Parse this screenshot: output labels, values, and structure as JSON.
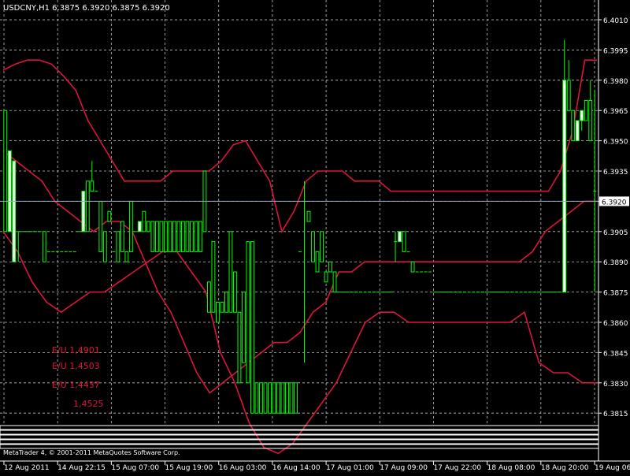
{
  "window": {
    "symbol_header": "USDCNY,H1  6.3875 6.3920 6.3875 6.3920",
    "footer": "MetaTrader 4, © 2001-2011 MetaQuotes Software Corp."
  },
  "annotations": [
    "E/U 1,4901",
    "E/U 1,4503",
    "E/U 1,4437",
    "1,4525"
  ],
  "colors": {
    "background": "#000000",
    "grid": "#c0c0c0",
    "bars": "#00ff00",
    "candle_up_fill": "#ffffff",
    "bands": "#dc143c",
    "annotation_text": "#dc143c",
    "current_price_line": "#9aa6c8",
    "text": "#ffffff"
  },
  "chart_data": {
    "type": "candlestick",
    "title": "USDCNY,H1",
    "header_values": {
      "open": 6.3875,
      "high": 6.392,
      "low": 6.3875,
      "close": 6.392
    },
    "current_price": 6.392,
    "current_price_label": "6.3920",
    "y_ticks": [
      "6.4010",
      "6.3995",
      "6.3980",
      "6.3965",
      "6.3950",
      "6.3935",
      "6.3920",
      "6.3905",
      "6.3890",
      "6.3875",
      "6.3860",
      "6.3845",
      "6.3830",
      "6.3815"
    ],
    "x_ticks": [
      "12 Aug 2011",
      "14 Aug 22:15",
      "15 Aug 07:00",
      "15 Aug 19:00",
      "16 Aug 03:00",
      "16 Aug 14:00",
      "17 Aug 01:00",
      "17 Aug 09:00",
      "17 Aug 22:00",
      "18 Aug 08:00",
      "18 Aug 20:00",
      "19 Aug 06:00"
    ],
    "ylim": [
      6.381,
      6.4019
    ],
    "grid": true,
    "candles_ohlc": [
      [
        6.3965,
        6.3965,
        6.3905,
        6.3905
      ],
      [
        6.3905,
        6.3945,
        6.3905,
        6.3945
      ],
      [
        6.389,
        6.394,
        6.389,
        6.394
      ],
      [
        6.3905,
        6.3905,
        6.389,
        6.3905
      ],
      [
        6.3905,
        6.3905,
        6.3905,
        6.3905
      ],
      [
        6.3905,
        6.3905,
        6.3905,
        6.3905
      ],
      [
        6.3905,
        6.3905,
        6.3905,
        6.3905
      ],
      [
        6.3905,
        6.3905,
        6.3905,
        6.3905
      ],
      [
        6.3905,
        6.3905,
        6.3905,
        6.3905
      ],
      [
        6.3905,
        6.3905,
        6.389,
        6.389
      ],
      [
        6.3895,
        6.3895,
        6.3895,
        6.3895
      ],
      [
        6.3895,
        6.3895,
        6.3895,
        6.3895
      ],
      [
        6.3895,
        6.3895,
        6.3895,
        6.3895
      ],
      [
        6.3895,
        6.3895,
        6.3895,
        6.3895
      ],
      [
        6.3895,
        6.3895,
        6.3895,
        6.3895
      ],
      [
        6.3895,
        6.3895,
        6.3895,
        6.3895
      ],
      [
        6.3895,
        6.3895,
        6.3895,
        6.3895
      ],
      [
        6.3905,
        6.3905,
        6.3905,
        6.3905
      ],
      [
        6.3905,
        6.3925,
        6.3905,
        6.3925
      ],
      [
        6.393,
        6.393,
        6.3905,
        6.3905
      ],
      [
        6.393,
        6.394,
        6.3925,
        6.3925
      ],
      [
        6.3925,
        6.3925,
        6.3925,
        6.3925
      ],
      [
        6.392,
        6.392,
        6.3895,
        6.3895
      ],
      [
        6.3905,
        6.3905,
        6.389,
        6.389
      ],
      [
        6.3915,
        6.3915,
        6.391,
        6.391
      ],
      [
        6.3895,
        6.3895,
        6.3895,
        6.3895
      ],
      [
        6.3905,
        6.3905,
        6.389,
        6.389
      ],
      [
        6.391,
        6.391,
        6.3895,
        6.3895
      ],
      [
        6.3895,
        6.3895,
        6.389,
        6.389
      ],
      [
        6.392,
        6.392,
        6.3895,
        6.3895
      ],
      [
        6.3905,
        6.3905,
        6.3905,
        6.3905
      ],
      [
        6.3905,
        6.3905,
        6.391,
        6.391
      ],
      [
        6.3915,
        6.3915,
        6.3905,
        6.3905
      ],
      [
        6.391,
        6.391,
        6.3905,
        6.3905
      ],
      [
        6.391,
        6.391,
        6.3895,
        6.3895
      ],
      [
        6.391,
        6.391,
        6.3895,
        6.3895
      ],
      [
        6.391,
        6.391,
        6.3895,
        6.3895
      ],
      [
        6.391,
        6.391,
        6.3895,
        6.3895
      ],
      [
        6.391,
        6.391,
        6.3895,
        6.3895
      ],
      [
        6.391,
        6.391,
        6.3895,
        6.3895
      ],
      [
        6.391,
        6.391,
        6.3895,
        6.3895
      ],
      [
        6.391,
        6.391,
        6.3895,
        6.3895
      ],
      [
        6.391,
        6.391,
        6.3895,
        6.3895
      ],
      [
        6.391,
        6.391,
        6.3895,
        6.3895
      ],
      [
        6.391,
        6.391,
        6.3895,
        6.3895
      ],
      [
        6.391,
        6.391,
        6.3895,
        6.3895
      ],
      [
        6.3935,
        6.3935,
        6.3905,
        6.3905
      ],
      [
        6.388,
        6.388,
        6.3865,
        6.3865
      ],
      [
        6.39,
        6.39,
        6.3865,
        6.3865
      ],
      [
        6.387,
        6.387,
        6.386,
        6.386
      ],
      [
        6.387,
        6.387,
        6.3865,
        6.3865
      ],
      [
        6.3875,
        6.3875,
        6.3865,
        6.3865
      ],
      [
        6.3905,
        6.3905,
        6.3865,
        6.3865
      ],
      [
        6.3885,
        6.3885,
        6.3865,
        6.3865
      ],
      [
        6.3865,
        6.3865,
        6.383,
        6.383
      ],
      [
        6.3875,
        6.3875,
        6.384,
        6.384
      ],
      [
        6.39,
        6.39,
        6.383,
        6.383
      ],
      [
        6.39,
        6.39,
        6.3815,
        6.3815
      ],
      [
        6.383,
        6.383,
        6.3815,
        6.3815
      ],
      [
        6.383,
        6.383,
        6.3815,
        6.3815
      ],
      [
        6.383,
        6.383,
        6.3815,
        6.3815
      ],
      [
        6.383,
        6.383,
        6.3815,
        6.3815
      ],
      [
        6.383,
        6.383,
        6.3815,
        6.3815
      ],
      [
        6.383,
        6.383,
        6.3815,
        6.3815
      ],
      [
        6.383,
        6.383,
        6.3815,
        6.3815
      ],
      [
        6.383,
        6.383,
        6.3815,
        6.3815
      ],
      [
        6.383,
        6.383,
        6.3815,
        6.3815
      ],
      [
        6.383,
        6.383,
        6.3815,
        6.3815
      ],
      [
        6.3895,
        6.3895,
        6.3895,
        6.3895
      ],
      [
        6.392,
        6.393,
        6.384,
        6.392
      ],
      [
        6.3915,
        6.3915,
        6.391,
        6.391
      ],
      [
        6.3905,
        6.3905,
        6.389,
        6.389
      ],
      [
        6.3895,
        6.3895,
        6.3885,
        6.3885
      ],
      [
        6.3905,
        6.3905,
        6.389,
        6.389
      ],
      [
        6.3885,
        6.3885,
        6.388,
        6.388
      ],
      [
        6.389,
        6.389,
        6.3885,
        6.3885
      ],
      [
        6.3885,
        6.3885,
        6.3875,
        6.3875
      ],
      [
        6.3875,
        6.3875,
        6.3875,
        6.3875
      ],
      [
        6.3875,
        6.3875,
        6.3875,
        6.3875
      ],
      [
        6.3875,
        6.3875,
        6.3875,
        6.3875
      ],
      [
        6.3875,
        6.3875,
        6.3875,
        6.3875
      ],
      [
        6.3875,
        6.3875,
        6.3875,
        6.3875
      ],
      [
        6.3875,
        6.3875,
        6.3875,
        6.3875
      ],
      [
        6.3875,
        6.3875,
        6.3875,
        6.3875
      ],
      [
        6.3875,
        6.3875,
        6.3875,
        6.3875
      ],
      [
        6.3875,
        6.3875,
        6.3875,
        6.3875
      ],
      [
        6.3875,
        6.3875,
        6.3875,
        6.3875
      ],
      [
        6.3875,
        6.3875,
        6.3875,
        6.3875
      ],
      [
        6.3875,
        6.3875,
        6.3875,
        6.3875
      ],
      [
        6.3875,
        6.3875,
        6.3875,
        6.3875
      ],
      [
        6.39,
        6.3905,
        6.389,
        6.39
      ],
      [
        6.39,
        6.3905,
        6.39,
        6.3905
      ],
      [
        6.3905,
        6.3905,
        6.3895,
        6.3895
      ],
      [
        6.3895,
        6.3895,
        6.3895,
        6.3895
      ],
      [
        6.389,
        6.389,
        6.3885,
        6.3885
      ],
      [
        6.3885,
        6.3885,
        6.3885,
        6.3885
      ],
      [
        6.3885,
        6.3885,
        6.3885,
        6.3885
      ],
      [
        6.3885,
        6.3885,
        6.3885,
        6.3885
      ],
      [
        6.3885,
        6.3885,
        6.3885,
        6.3885
      ],
      [
        6.3875,
        6.3875,
        6.3875,
        6.3875
      ],
      [
        6.3875,
        6.3875,
        6.3875,
        6.3875
      ],
      [
        6.3875,
        6.3875,
        6.3875,
        6.3875
      ],
      [
        6.3875,
        6.3875,
        6.3875,
        6.3875
      ],
      [
        6.3875,
        6.3875,
        6.3875,
        6.3875
      ],
      [
        6.3875,
        6.3875,
        6.3875,
        6.3875
      ],
      [
        6.3875,
        6.3875,
        6.3875,
        6.3875
      ],
      [
        6.3875,
        6.3875,
        6.3875,
        6.3875
      ],
      [
        6.3875,
        6.3875,
        6.3875,
        6.3875
      ],
      [
        6.3875,
        6.3875,
        6.3875,
        6.3875
      ],
      [
        6.3875,
        6.3875,
        6.3875,
        6.3875
      ],
      [
        6.3875,
        6.3875,
        6.3875,
        6.3875
      ],
      [
        6.3875,
        6.3875,
        6.3875,
        6.3875
      ],
      [
        6.3875,
        6.3875,
        6.3875,
        6.3875
      ],
      [
        6.3875,
        6.3875,
        6.3875,
        6.3875
      ],
      [
        6.3875,
        6.3875,
        6.3875,
        6.3875
      ],
      [
        6.3875,
        6.3875,
        6.3875,
        6.3875
      ],
      [
        6.3875,
        6.3875,
        6.3875,
        6.3875
      ],
      [
        6.3875,
        6.3875,
        6.3875,
        6.3875
      ],
      [
        6.3875,
        6.3875,
        6.3875,
        6.3875
      ],
      [
        6.3875,
        6.3875,
        6.3875,
        6.3875
      ],
      [
        6.3875,
        6.3875,
        6.3875,
        6.3875
      ],
      [
        6.3875,
        6.3875,
        6.3875,
        6.3875
      ],
      [
        6.3875,
        6.3875,
        6.3875,
        6.3875
      ],
      [
        6.3875,
        6.3875,
        6.3875,
        6.3875
      ],
      [
        6.3875,
        6.3875,
        6.3875,
        6.3875
      ],
      [
        6.3875,
        6.3875,
        6.3875,
        6.3875
      ],
      [
        6.3875,
        6.3875,
        6.3875,
        6.3875
      ],
      [
        6.3875,
        6.3875,
        6.3875,
        6.3875
      ],
      [
        6.3875,
        6.3875,
        6.3875,
        6.3875
      ],
      [
        6.3875,
        6.4,
        6.3875,
        6.398
      ],
      [
        6.398,
        6.399,
        6.3965,
        6.3965
      ],
      [
        6.3965,
        6.3965,
        6.395,
        6.395
      ],
      [
        6.395,
        6.396,
        6.395,
        6.396
      ],
      [
        6.396,
        6.3965,
        6.3955,
        6.3965
      ],
      [
        6.397,
        6.397,
        6.396,
        6.396
      ],
      [
        6.397,
        6.398,
        6.395,
        6.395
      ],
      [
        6.3925,
        6.3975,
        6.3875,
        6.3925
      ]
    ],
    "bands": {
      "upper": [
        6.3985,
        6.3988,
        6.399,
        6.399,
        6.3988,
        6.3982,
        6.3975,
        6.396,
        6.395,
        6.394,
        6.393,
        6.393,
        6.393,
        6.393,
        6.3935,
        6.3935,
        6.3935,
        6.3935,
        6.394,
        6.3948,
        6.395,
        6.394,
        6.393,
        6.3905,
        6.3915,
        6.393,
        6.3935,
        6.3935,
        6.3935,
        6.393,
        6.393,
        6.393,
        6.3925,
        6.3925,
        6.3925,
        6.3925,
        6.3925,
        6.3925,
        6.3925,
        6.3925,
        6.3925,
        6.3925,
        6.3925,
        6.3925,
        6.3925,
        6.3925,
        6.3935,
        6.3955,
        6.399,
        6.399
      ],
      "middle": [
        6.3945,
        6.394,
        6.3935,
        6.393,
        6.392,
        6.3915,
        6.391,
        6.3905,
        6.391,
        6.391,
        6.3905,
        6.389,
        6.3875,
        6.3865,
        6.385,
        6.3835,
        6.3825,
        6.383,
        6.3835,
        6.384,
        6.3845,
        6.385,
        6.385,
        6.3855,
        6.3865,
        6.387,
        6.3885,
        6.3885,
        6.389,
        6.389,
        6.389,
        6.389,
        6.389,
        6.389,
        6.389,
        6.389,
        6.389,
        6.389,
        6.389,
        6.389,
        6.389,
        6.3895,
        6.3905,
        6.391,
        6.3915,
        6.392,
        6.392
      ],
      "lower": [
        6.3905,
        6.3895,
        6.388,
        6.387,
        6.3865,
        6.387,
        6.3875,
        6.3875,
        6.388,
        6.3885,
        6.389,
        6.3895,
        6.3895,
        6.3885,
        6.3875,
        6.3845,
        6.383,
        6.381,
        6.3798,
        6.3795,
        6.38,
        6.381,
        6.382,
        6.383,
        6.3845,
        6.386,
        6.3865,
        6.3865,
        6.386,
        6.386,
        6.386,
        6.386,
        6.386,
        6.386,
        6.386,
        6.386,
        6.3865,
        6.384,
        6.3835,
        6.3835,
        6.383,
        6.383
      ]
    }
  }
}
